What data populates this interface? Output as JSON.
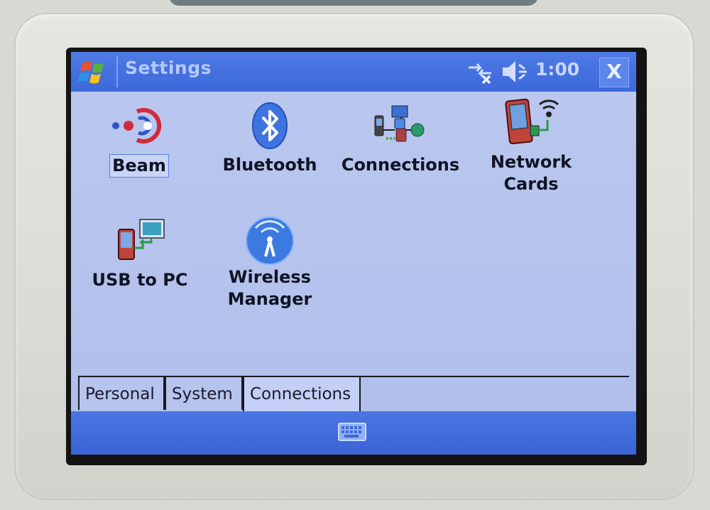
{
  "titlebar": {
    "title": "Settings",
    "clock": "1:00",
    "close_label": "X"
  },
  "icons": {
    "start": "windows-flag-icon",
    "connectivity": "connectivity-icon",
    "volume": "speaker-icon",
    "keyboard": "keyboard-icon"
  },
  "items": [
    {
      "line1": "Beam",
      "line2": "",
      "icon": "beam-icon",
      "selected": true
    },
    {
      "line1": "Bluetooth",
      "line2": "",
      "icon": "bluetooth-icon"
    },
    {
      "line1": "Connections",
      "line2": "",
      "icon": "connections-icon"
    },
    {
      "line1": "Network",
      "line2": "Cards",
      "icon": "network-cards-icon"
    },
    {
      "line1": "USB to PC",
      "line2": "",
      "icon": "usb-to-pc-icon"
    },
    {
      "line1": "Wireless",
      "line2": "Manager",
      "icon": "wireless-manager-icon"
    }
  ],
  "tabs": [
    {
      "label": "Personal"
    },
    {
      "label": "System"
    },
    {
      "label": "Connections",
      "active": true
    }
  ],
  "colors": {
    "titlebar": "#3c68da",
    "content_bg": "#b3c2ee",
    "text": "#101423"
  }
}
